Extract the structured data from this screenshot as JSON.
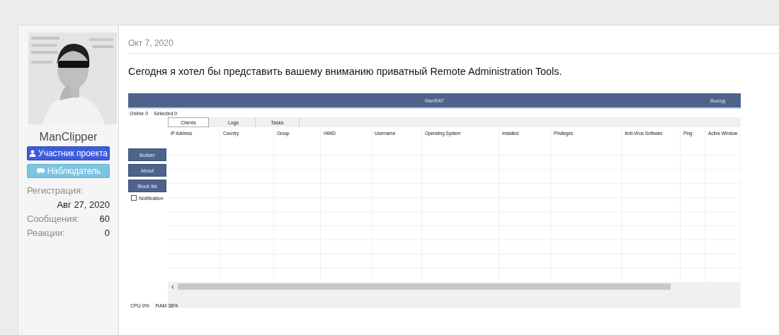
{
  "user": {
    "name": "ManClipper",
    "badges": [
      {
        "label": "Участник проекта",
        "kind": "member"
      },
      {
        "label": "Наблюдатель",
        "kind": "observer"
      }
    ],
    "stats": [
      {
        "label": "Регистрация:",
        "value": "Авг 27, 2020",
        "kind": "stacked"
      },
      {
        "label": "Сообщения:",
        "value": "60",
        "kind": "inline"
      },
      {
        "label": "Реакции:",
        "value": "0",
        "kind": "inline"
      }
    ]
  },
  "post": {
    "date": "Окт 7, 2020",
    "text": "Сегодня я хотел бы представить вашему вниманию приватный Remote Administration Tools."
  },
  "app": {
    "title": "ManRAT",
    "exit": "Выход",
    "online": "Online 0",
    "selected_count": "Selected 0",
    "tabs": [
      {
        "label": "Clients",
        "selected": true
      },
      {
        "label": "Logs",
        "selected": false
      },
      {
        "label": "Tasks",
        "selected": false
      }
    ],
    "side_buttons": [
      "Builder",
      "About",
      "Block list"
    ],
    "notification": {
      "label": "Notification",
      "checked": false
    },
    "columns": [
      "IP Address",
      "Country",
      "Group",
      "HWID",
      "Username",
      "Operating System",
      "Installed",
      "Privileges",
      "Anti-Virus Software",
      "Ping",
      "Active Window"
    ],
    "status": {
      "cpu": "CPU 0%",
      "ram": "RAM 38%"
    }
  }
}
